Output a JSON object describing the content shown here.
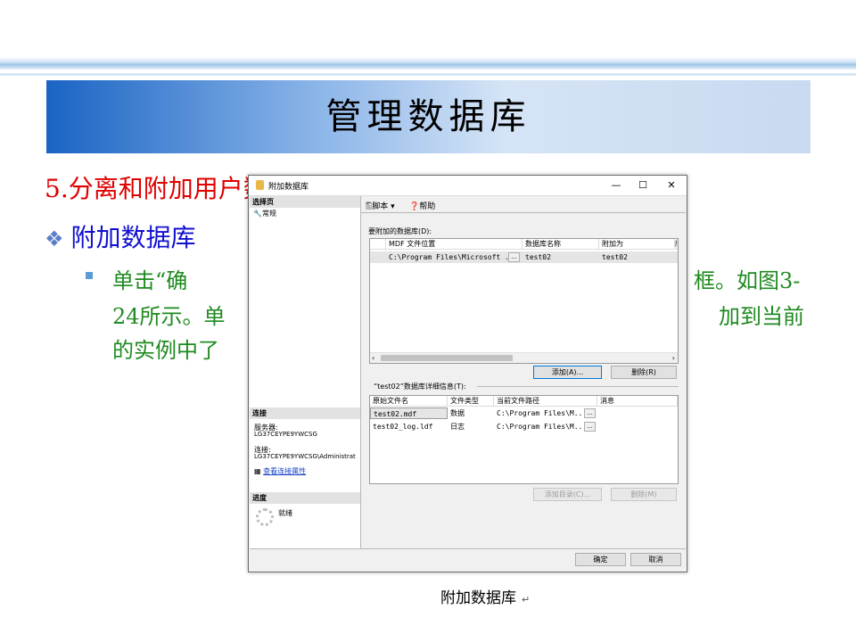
{
  "slide": {
    "title": "管理数据库",
    "section": "5.分离和附加用户数据库",
    "subsection": "附加数据库",
    "line1_left": "单击“确",
    "line1_right": "框。如图3-",
    "line2_left": "24所示。单",
    "line2_right": "加到当前",
    "line3_left": "的实例中了",
    "caption": "附加数据库",
    "caption_mark": "↵"
  },
  "dialog": {
    "title": "附加数据库",
    "minimize": "—",
    "maximize": "☐",
    "close": "✕",
    "left": {
      "select_page_header": "选择页",
      "page_general": "常规",
      "connection_header": "连接",
      "server_label": "服务器:",
      "server_value": "LG37CEYPE9YWCSG",
      "connection_label": "连接:",
      "connection_value": "LG37CEYPE9YWCSG\\Administrat",
      "view_connection_props": "查看连接属性",
      "progress_header": "进度",
      "progress_status": "就绪"
    },
    "toolbar": {
      "script": "脚本",
      "help": "帮助"
    },
    "attach_section": {
      "label": "要附加的数据库(D):",
      "columns": [
        "MDF 文件位置",
        "数据库名称",
        "附加为",
        "所"
      ],
      "rows": [
        {
          "mdf_location": "C:\\Program Files\\Microsoft ...",
          "db_name": "test02",
          "attach_as": "test02"
        }
      ],
      "add_button": "添加(A)...",
      "remove_button": "删除(R)"
    },
    "details_section": {
      "label": "“test02”数据库详细信息(T):",
      "columns": [
        "原始文件名",
        "文件类型",
        "当前文件路径",
        "消息"
      ],
      "rows": [
        {
          "file": "test02.mdf",
          "type": "数据",
          "path": "C:\\Program Files\\M..."
        },
        {
          "file": "test02_log.ldf",
          "type": "日志",
          "path": "C:\\Program Files\\M..."
        }
      ],
      "add_catalog_button": "添加目录(C)...",
      "remove_button": "删除(M)"
    },
    "ok_button": "确定",
    "cancel_button": "取消",
    "ellipsis": "..."
  }
}
